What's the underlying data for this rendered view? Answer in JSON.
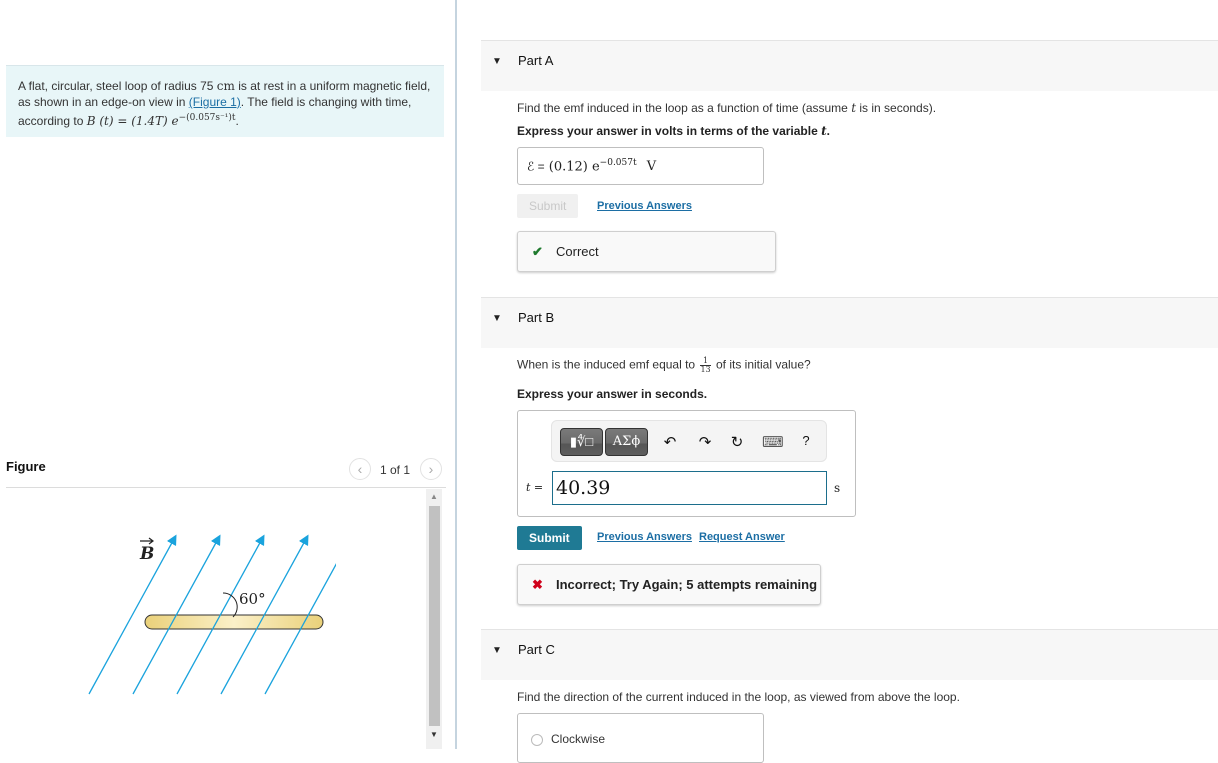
{
  "problem": {
    "text_before_radius": "A flat, circular, steel loop of radius 75",
    "radius_unit": "cm",
    "text_after_radius": " is at rest in a uniform magnetic field, as shown in an edge-on view in ",
    "figure_link": "(Figure 1)",
    "text_after_link": ". The field is changing with time, according to ",
    "equation_lhs": "B (t) = (1.4T) e",
    "equation_exponent": "−(0.057s⁻¹)t",
    "equation_end": "."
  },
  "figure": {
    "title": "Figure",
    "pager": "1 of 1",
    "prev_icon": "chevron-left-icon",
    "next_icon": "chevron-right-icon",
    "field_label": "B",
    "angle_label": "60°",
    "field_color": "#1aa3dd",
    "loop_color": "#f2d67a"
  },
  "partA": {
    "title": "Part A",
    "question_pre": "Find the emf induced in the loop as a function of time (assume ",
    "question_var": "t",
    "question_post": " is in seconds).",
    "instruction_pre": "Express your answer in volts in terms of the variable ",
    "instruction_var": "t",
    "instruction_post": ".",
    "answer_lhs": "ℰ =",
    "answer_value": "(0.12) e",
    "answer_exponent": "−0.057t",
    "answer_unit": "V",
    "submit_label": "Submit",
    "previous_answers_label": "Previous Answers",
    "feedback": "Correct",
    "feedback_icon": "✔",
    "feedback_color": "#1f7a2e"
  },
  "partB": {
    "title": "Part B",
    "question_pre": "When is the induced emf equal to",
    "fraction_num": "1",
    "fraction_den": "13",
    "question_post": "of its initial value?",
    "instruction": "Express your answer in seconds.",
    "toolbar": {
      "template_btn": "▮∜□",
      "greek_btn": "ΑΣϕ",
      "undo_icon": "↶",
      "redo_icon": "↷",
      "reset_icon": "↻",
      "keyboard_icon": "⌨",
      "help_icon": "?"
    },
    "input_label": "t =",
    "input_value": "40.39",
    "unit": "s",
    "submit_label": "Submit",
    "previous_answers_label": "Previous Answers",
    "request_answer_label": "Request Answer",
    "feedback": "Incorrect; Try Again; 5 attempts remaining",
    "feedback_icon": "✖",
    "feedback_color": "#d0021b"
  },
  "partC": {
    "title": "Part C",
    "question": "Find the direction of the current induced in the loop, as viewed from above the loop.",
    "options": [
      "Clockwise"
    ]
  },
  "colors": {
    "accent": "#1f7a94",
    "link": "#1c6ea4",
    "problem_bg": "#e8f6f8"
  }
}
